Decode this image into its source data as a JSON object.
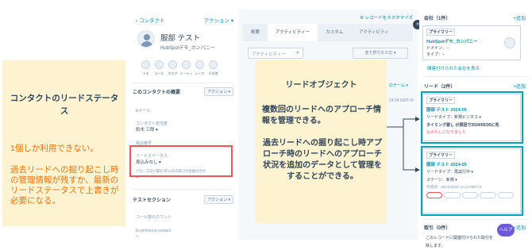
{
  "contact_panel": {
    "back_link": "‹ コンタクト",
    "actions_menu": "アクション ▾",
    "name": "服部 テスト",
    "company": "HubSpotデモ_カンパニー",
    "actions": [
      {
        "label": "メモ",
        "icon": "note-icon"
      },
      {
        "label": "コール",
        "icon": "phone-icon"
      },
      {
        "label": "タスク",
        "icon": "task-icon"
      },
      {
        "label": "ミーティ",
        "icon": "calendar-icon"
      },
      {
        "label": "シーケ",
        "icon": "sequence-icon"
      },
      {
        "label": "その他",
        "icon": "more-icon"
      }
    ],
    "about_section": {
      "title": "このコンタクトの概要",
      "actions_button": "アクション ▾",
      "email_label": "Eメール",
      "owner_label": "コンタクト担当者",
      "owner_value": "鈴木 三郎 ▾",
      "phone_label": "電話番号",
      "lead_status_label": "リードステータス",
      "lead_status_value": "見込みなし ▾",
      "close_date_label": "クローズ日が最近1年以内の取引の金額の合計",
      "close_date_value": "--"
    },
    "test_section": {
      "title": "テストセクション",
      "actions_button": "アクション ▾",
      "call_count_label": "コール数のカウント",
      "ecommerce_label": "Ecommerce contact",
      "ecommerce_value": "--"
    }
  },
  "activity_panel": {
    "customize_link": "⚙ レコードをカスタマイズ",
    "tabs": [
      "概要",
      "アクティビティー",
      "カスタム",
      "アクティビティ"
    ],
    "search_placeholder": "アクティビティー",
    "collapse_all": "全て折りたたむ ▾",
    "behind_team": "のチーム ▾",
    "behind_time": "14:24 GMT+9"
  },
  "right_panel": {
    "company_section": {
      "title": "会社（1件）",
      "add_label": "+追加"
    },
    "company_card": {
      "badge": "プライマリー",
      "name": "HubSpotデモ_カンパニー",
      "domain_label": "ドメイン：--",
      "type_label": "タイプ：--"
    },
    "company_show_all": "関連付けられた会社を表示",
    "lead_section": {
      "title": "リード（2件）",
      "add_label": "+追加"
    },
    "lead_cards": [
      {
        "badge": "プライマリー",
        "name": "服部 テスト 2024-05",
        "type_line": "リードタイプ：新規ビジネス ▾",
        "detail_line1": "タイミング悪し が原因で2024/05/30に見",
        "detail_line2": "込みなしになりました"
      },
      {
        "badge": "プライマリー",
        "name": "服部 テスト 2024-05",
        "type_line": "リードタイプ：再試行中 ▾",
        "stage_line": "ステージ：新規 ▾",
        "created_line": "作成日：2024/05/29 14:14 GMT+9"
      }
    ],
    "deals_section": {
      "title": "取引（0件）",
      "add_label": "+追加"
    },
    "deals_empty": "このレコードに関連付けられた取引を",
    "deals_empty2": "除します。",
    "help": "ヘルプ"
  },
  "annotations": {
    "left_title": "コンタクトのリードステータス",
    "left_line1": "1個しか利用できない。",
    "left_line2": "過去リードへの掘り起こし時の管理情報が残すか、最新のリードステータスで上書きが必要になる。",
    "center_title": "リードオブジェクト",
    "center_body1": "複数回のリードへのアプローチ情報を管理できる。",
    "center_body2": "過去リードへの掘り起こし時アプローチ時のリードへのアプローチ状況を追加のデータとして管理をすることができる。"
  },
  "colors": {
    "annotation_bg": "#fdf3d0",
    "annotation_orange": "#e8740f",
    "highlight_red": "#f2545b",
    "highlight_teal": "#00a4bd",
    "link": "#0091ae"
  }
}
